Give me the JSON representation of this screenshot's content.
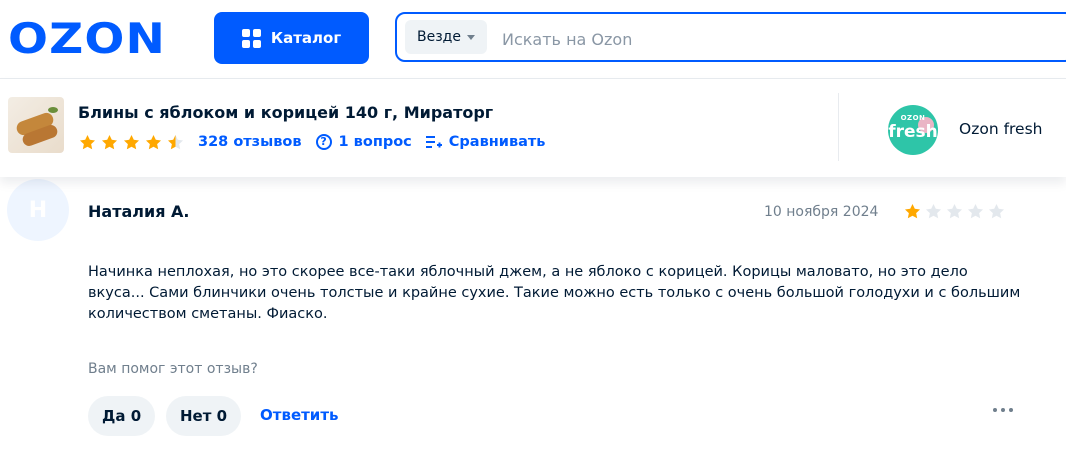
{
  "header": {
    "logo": "OZON",
    "catalog_label": "Каталог",
    "search_scope": "Везде",
    "search_placeholder": "Искать на Ozon",
    "search_value": ""
  },
  "product": {
    "title": "Блины с яблоком и корицей 140 г, Мираторг",
    "rating": 4.5,
    "reviews_link": "328 отзывов",
    "questions_link": "1 вопрос",
    "compare_link": "Сравнивать",
    "seller_logo_small": "OZON",
    "seller_logo_big": "fresh",
    "seller_name": "Ozon fresh"
  },
  "review": {
    "avatar_letter": "Н",
    "author": "Наталия А.",
    "date": "10 ноября 2024",
    "rating": 1,
    "text": "Начинка неплохая, но это скорее все-таки яблочный джем, а не яблоко с корицей. Корицы маловато, но это дело вкуса... Сами блинчики очень толстые и крайне сухие. Такие можно есть только с очень большой голодухи и с большим количеством сметаны. Фиаско.",
    "helpful_question": "Вам помог этот отзыв?",
    "yes_label": "Да 0",
    "no_label": "Нет 0",
    "reply_label": "Ответить"
  },
  "colors": {
    "brand": "#005bff",
    "star": "#ffa800",
    "star_empty": "#e3e8ed",
    "fresh": "#2ec5a8"
  }
}
